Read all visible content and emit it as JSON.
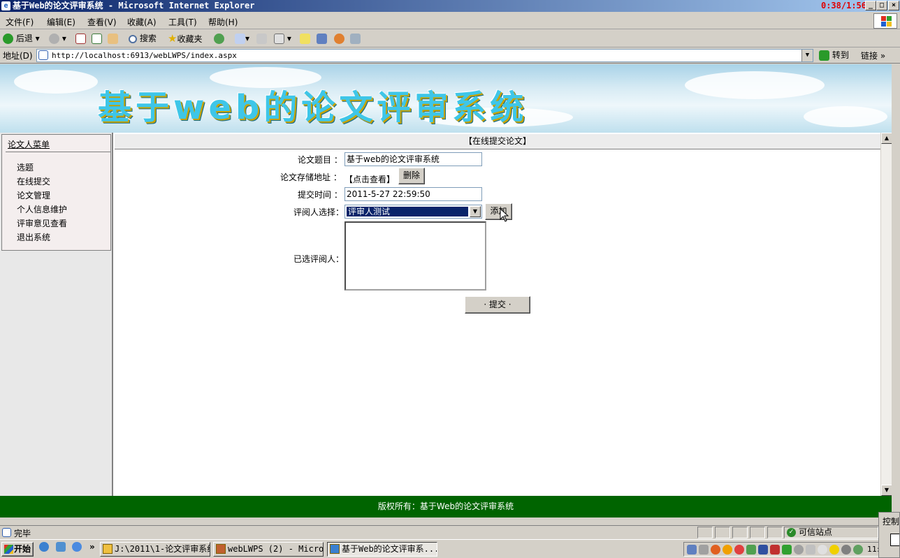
{
  "window": {
    "title": "基于Web的论文评审系统 - Microsoft Internet Explorer",
    "clock": "0:38/1:56",
    "controls": [
      "_",
      "□",
      "×"
    ]
  },
  "menubar": [
    "文件(F)",
    "编辑(E)",
    "查看(V)",
    "收藏(A)",
    "工具(T)",
    "帮助(H)"
  ],
  "toolbar": {
    "back": "后退",
    "search": "搜索",
    "favorites": "收藏夹"
  },
  "address": {
    "label": "地址(D)",
    "url": "http://localhost:6913/webLWPS/index.aspx",
    "go": "转到",
    "links": "链接"
  },
  "banner": {
    "title": "基于web的论文评审系统"
  },
  "sidebar": {
    "heading": "论文人菜单",
    "items": [
      "选题",
      "在线提交",
      "论文管理",
      "个人信息维护",
      "评审意见查看",
      "退出系统"
    ]
  },
  "form": {
    "header": "【在线提交论文】",
    "title_label": "论文题目 ：",
    "title_value": "基于web的论文评审系统",
    "storage_label": "论文存储地址 ：",
    "storage_link": "【点击查看】",
    "delete_btn": "删除",
    "time_label": "提交时间 ：",
    "time_value": "2011-5-27 22:59:50",
    "reviewer_label": "评阅人选择：",
    "reviewer_selected": "评审人测试",
    "add_btn": "添加",
    "chosen_label": "已选评阅人：",
    "submit_btn": "· 提交 ·"
  },
  "footer": "版权所有：基于Web的论文评审系统",
  "statusbar": {
    "text": "完毕",
    "zone": "可信站点"
  },
  "taskbar": {
    "start": "开始",
    "tasks": [
      {
        "label": "J:\\2011\\1-论文评审系统"
      },
      {
        "label": "webLWPS (2) - Micro..."
      },
      {
        "label": "基于Web的论文评审系..."
      }
    ],
    "time": "11:",
    "popup": "控制"
  }
}
